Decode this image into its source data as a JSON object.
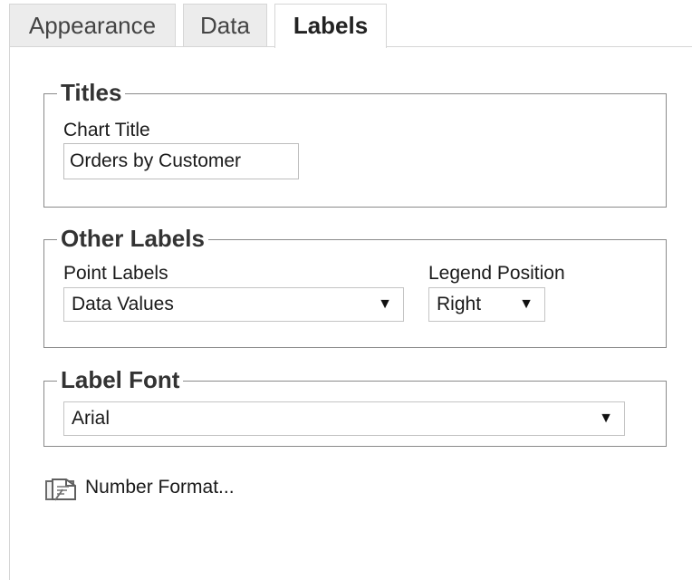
{
  "tabs": {
    "appearance": "Appearance",
    "data": "Data",
    "labels": "Labels",
    "active": "Labels"
  },
  "titles_group": {
    "heading": "Titles",
    "chart_title_label": "Chart Title",
    "chart_title_value": "Orders by Customer"
  },
  "other_labels_group": {
    "heading": "Other Labels",
    "point_labels_label": "Point Labels",
    "point_labels_value": "Data Values",
    "legend_position_label": "Legend Position",
    "legend_position_value": "Right"
  },
  "label_font_group": {
    "heading": "Label Font",
    "font_value": "Arial"
  },
  "number_format": {
    "label": "Number Format..."
  },
  "icons": {
    "dropdown_arrow": "▼",
    "number_format_icon": "format-icon"
  }
}
